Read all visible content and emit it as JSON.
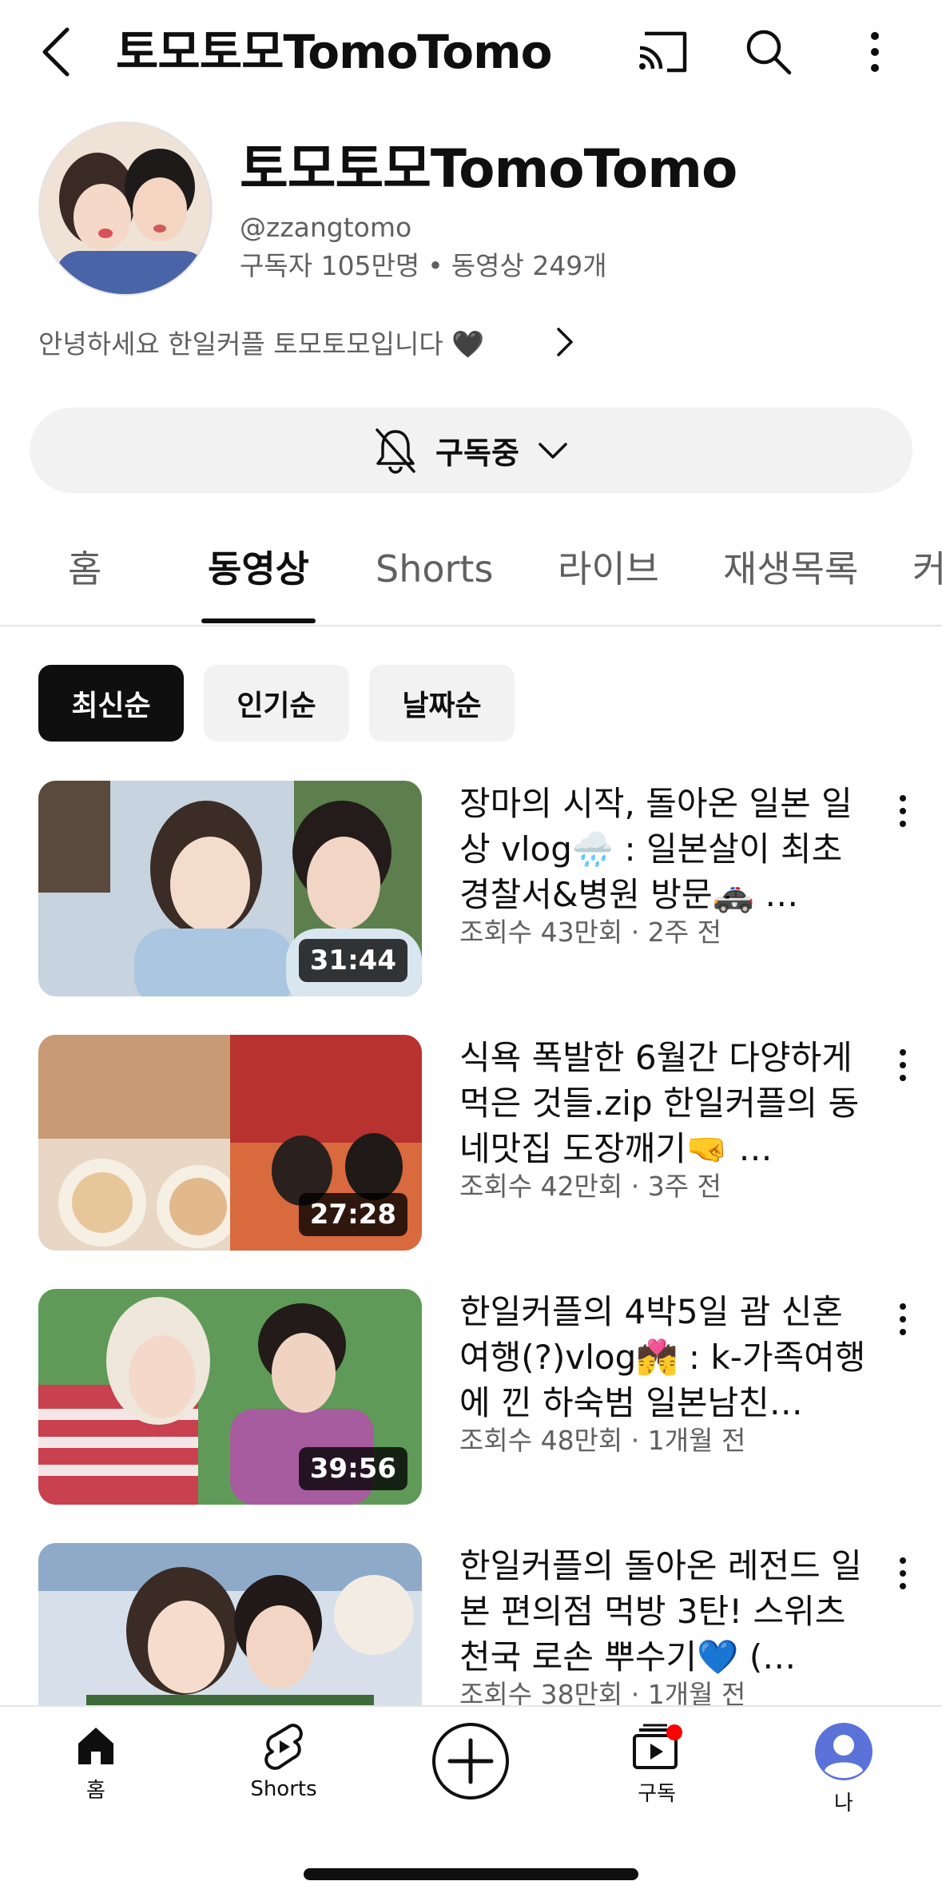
{
  "topbar": {
    "title": "토모토모TomoTomo",
    "icons": [
      "back-icon",
      "cast-icon",
      "search-icon",
      "more-vert-icon"
    ]
  },
  "channel": {
    "name": "토모토모TomoTomo",
    "handle": "@zzangtomo",
    "subscribers": "구독자 105만명",
    "videos": "동영상 249개",
    "separator": "•",
    "description": "안녕하세요 한일커플 토모토모입니다 🖤"
  },
  "subscribe": {
    "label": "구독중",
    "icons": [
      "bell-off-icon",
      "chevron-down-icon"
    ]
  },
  "tabs": [
    {
      "label": "홈",
      "active": false
    },
    {
      "label": "동영상",
      "active": true
    },
    {
      "label": "Shorts",
      "active": false
    },
    {
      "label": "라이브",
      "active": false
    },
    {
      "label": "재생목록",
      "active": false
    },
    {
      "label": "커",
      "active": false
    }
  ],
  "chips": [
    {
      "label": "최신순",
      "active": true
    },
    {
      "label": "인기순",
      "active": false
    },
    {
      "label": "날짜순",
      "active": false
    }
  ],
  "videos": [
    {
      "title": "장마의 시작, 돌아온 일본 일상 vlog🌧️ : 일본살이 최초 경찰서&병원 방문🚓 …",
      "meta": "조회수 43만회 · 2주 전",
      "duration": "31:44",
      "thumb_colors": [
        "#b9c7d6",
        "#e9e4dc",
        "#6f8fa8"
      ]
    },
    {
      "title": "식욕 폭발한 6월간 다양하게 먹은 것들.zip 한일커플의 동네맛집 도장깨기🤜 …",
      "meta": "조회수 42만회 · 3주 전",
      "duration": "27:28",
      "thumb_colors": [
        "#c98a5e",
        "#f0e2cf",
        "#b8322f"
      ]
    },
    {
      "title": "한일커플의 4박5일 괌 신혼 여행(?)vlog💏 : k-가족여행에 낀 하숙범 일본남친…",
      "meta": "조회수 48만회 · 1개월 전",
      "duration": "39:56",
      "thumb_colors": [
        "#4f8a4a",
        "#e6c8c0",
        "#b83a4a"
      ]
    },
    {
      "title": "한일커플의 돌아온 레전드 일본 편의점 먹방 3탄! 스위츠 천국 로손 뿌수기💙 (…",
      "meta": "조회수 38만회 · 1개월 전",
      "duration": "",
      "thumb_colors": [
        "#8fa9c8",
        "#f1e7dc",
        "#3f6b3a"
      ]
    }
  ],
  "bottom_nav": [
    {
      "label": "홈",
      "icon": "home-icon"
    },
    {
      "label": "Shorts",
      "icon": "shorts-icon"
    },
    {
      "label": "",
      "icon": "create-plus-icon"
    },
    {
      "label": "구독",
      "icon": "subscriptions-icon"
    },
    {
      "label": "나",
      "icon": "account-avatar-icon"
    }
  ]
}
